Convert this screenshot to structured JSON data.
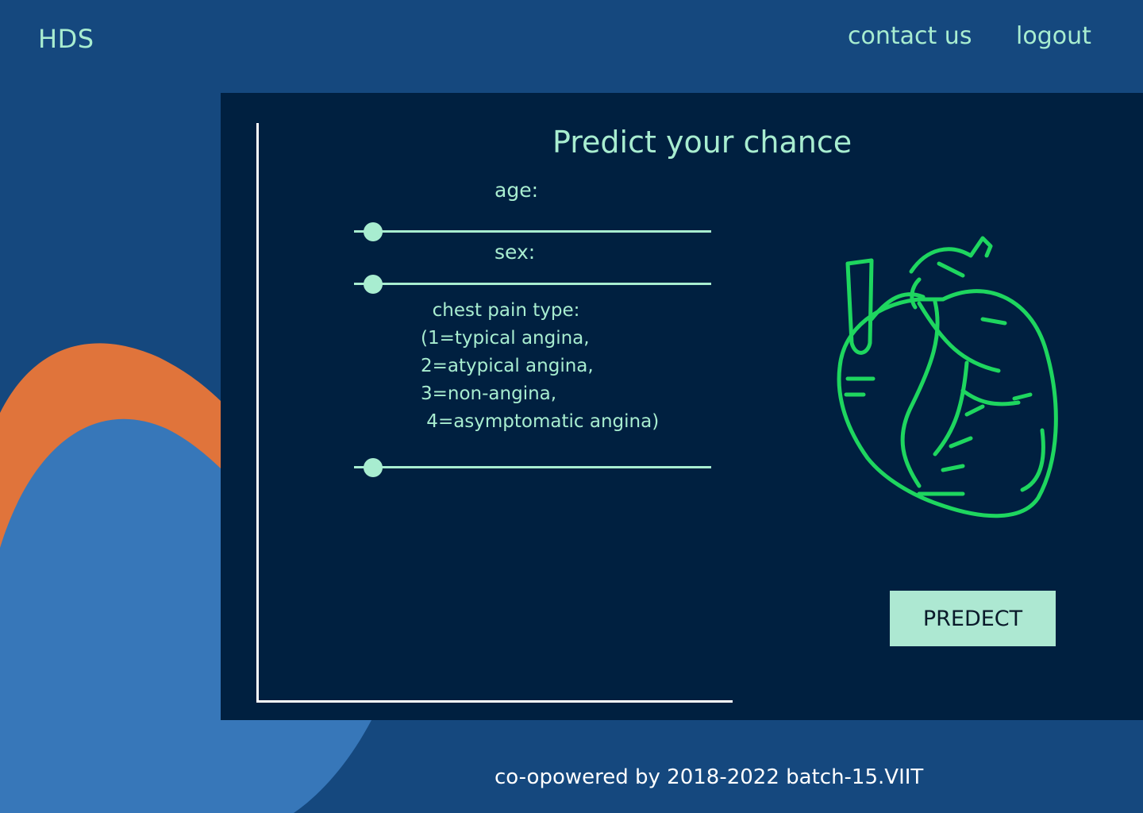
{
  "header": {
    "brand": "HDS",
    "nav": {
      "contact": "contact us",
      "logout": "logout"
    }
  },
  "form": {
    "title": "Predict your chance",
    "fields": {
      "age": "age:",
      "sex": "sex:",
      "chest_pain": "  chest pain type:\n(1=typical angina,\n2=atypical angina,\n3=non-angina,\n 4=asymptomatic angina)"
    },
    "predict_button": "PREDECT"
  },
  "footer": {
    "credit": "co-opowered by 2018-2022 batch-15.VIIT"
  },
  "colors": {
    "background": "#15487e",
    "panel": "#002040",
    "accent": "#a8edd0",
    "heart_stroke": "#1ed65f",
    "wave_orange": "#e0743b",
    "wave_blue": "#3777b9"
  },
  "icons": {
    "heart": "anatomical-heart-icon"
  }
}
